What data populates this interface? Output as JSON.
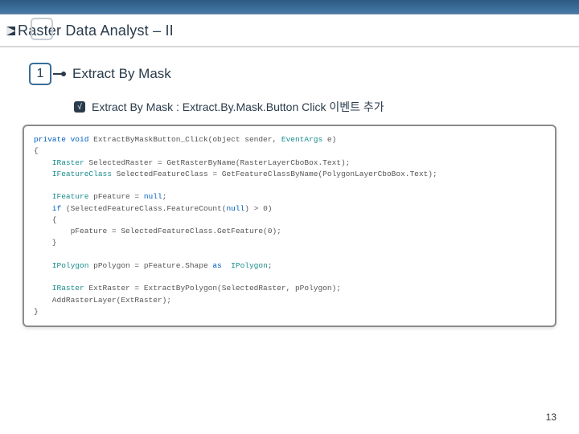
{
  "title": "Raster Data Analyst – II",
  "section": {
    "number": "1",
    "heading": "Extract By Mask"
  },
  "bullet": {
    "check": "√",
    "text": "Extract By Mask : Extract.By.Mask.Button Click 이벤트 추가"
  },
  "code": {
    "l1a": "private void",
    "l1b": " ExtractByMaskButton_Click(object sender, ",
    "l1c": "EventArgs",
    "l1d": " e)",
    "l2": "{",
    "l3a": "    IRaster",
    "l3b": " SelectedRaster = GetRasterByName(RasterLayerCboBox.Text);",
    "l4a": "    IFeatureClass",
    "l4b": " SelectedFeatureClass = GetFeatureClassByName(PolygonLayerCboBox.Text);",
    "l5": "",
    "l6a": "    IFeature",
    "l6b": " pFeature = ",
    "l6c": "null",
    "l6d": ";",
    "l7a": "    if",
    "l7b": " (SelectedFeatureClass.FeatureCount(",
    "l7c": "null",
    "l7d": ") > 0)",
    "l8": "    {",
    "l9": "        pFeature = SelectedFeatureClass.GetFeature(0);",
    "l10": "    }",
    "l11": "",
    "l12a": "    IPolygon",
    "l12b": " pPolygon = pFeature.Shape ",
    "l12c": "as",
    "l12d": "  ",
    "l12e": "IPolygon",
    "l12f": ";",
    "l13": "",
    "l14a": "    IRaster",
    "l14b": " ExtRaster = ExtractByPolygon(SelectedRaster, pPolygon);",
    "l15": "    AddRasterLayer(ExtRaster);",
    "l16": "}"
  },
  "page_number": "13"
}
